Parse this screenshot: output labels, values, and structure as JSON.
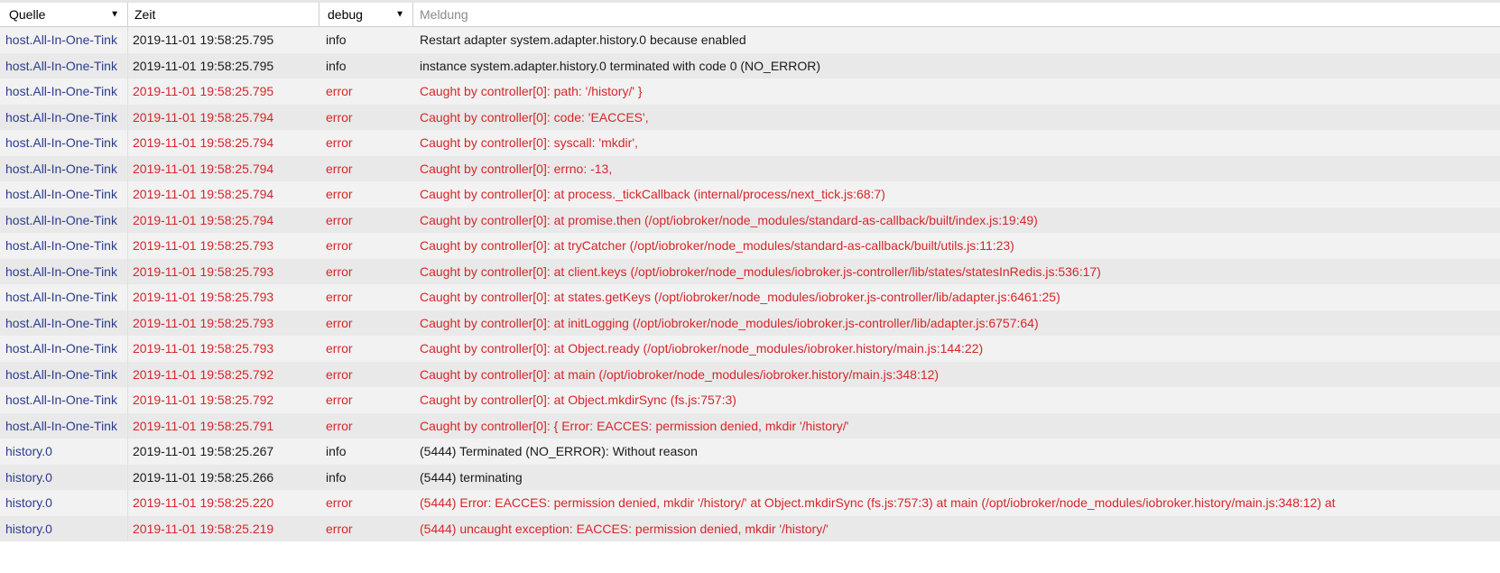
{
  "header": {
    "source_label": "Quelle",
    "time_label": "Zeit",
    "level_label": "debug",
    "message_placeholder": "Meldung"
  },
  "colors": {
    "source_text": "#2d3c8f",
    "error_text": "#d6262a",
    "info_text": "#1a1a1a",
    "row_odd": "#f2f2f2",
    "row_even": "#e9e9e9"
  },
  "rows": [
    {
      "source": "host.All-In-One-Tink",
      "time": "2019-11-01 19:58:25.795",
      "level": "info",
      "message": "Restart adapter system.adapter.history.0 because enabled"
    },
    {
      "source": "host.All-In-One-Tink",
      "time": "2019-11-01 19:58:25.795",
      "level": "info",
      "message": "instance system.adapter.history.0 terminated with code 0 (NO_ERROR)"
    },
    {
      "source": "host.All-In-One-Tink",
      "time": "2019-11-01 19:58:25.795",
      "level": "error",
      "message": "Caught by controller[0]: path: '/history/' }"
    },
    {
      "source": "host.All-In-One-Tink",
      "time": "2019-11-01 19:58:25.794",
      "level": "error",
      "message": "Caught by controller[0]: code: 'EACCES',"
    },
    {
      "source": "host.All-In-One-Tink",
      "time": "2019-11-01 19:58:25.794",
      "level": "error",
      "message": "Caught by controller[0]: syscall: 'mkdir',"
    },
    {
      "source": "host.All-In-One-Tink",
      "time": "2019-11-01 19:58:25.794",
      "level": "error",
      "message": "Caught by controller[0]: errno: -13,"
    },
    {
      "source": "host.All-In-One-Tink",
      "time": "2019-11-01 19:58:25.794",
      "level": "error",
      "message": "Caught by controller[0]: at process._tickCallback (internal/process/next_tick.js:68:7)"
    },
    {
      "source": "host.All-In-One-Tink",
      "time": "2019-11-01 19:58:25.794",
      "level": "error",
      "message": "Caught by controller[0]: at promise.then (/opt/iobroker/node_modules/standard-as-callback/built/index.js:19:49)"
    },
    {
      "source": "host.All-In-One-Tink",
      "time": "2019-11-01 19:58:25.793",
      "level": "error",
      "message": "Caught by controller[0]: at tryCatcher (/opt/iobroker/node_modules/standard-as-callback/built/utils.js:11:23)"
    },
    {
      "source": "host.All-In-One-Tink",
      "time": "2019-11-01 19:58:25.793",
      "level": "error",
      "message": "Caught by controller[0]: at client.keys (/opt/iobroker/node_modules/iobroker.js-controller/lib/states/statesInRedis.js:536:17)"
    },
    {
      "source": "host.All-In-One-Tink",
      "time": "2019-11-01 19:58:25.793",
      "level": "error",
      "message": "Caught by controller[0]: at states.getKeys (/opt/iobroker/node_modules/iobroker.js-controller/lib/adapter.js:6461:25)"
    },
    {
      "source": "host.All-In-One-Tink",
      "time": "2019-11-01 19:58:25.793",
      "level": "error",
      "message": "Caught by controller[0]: at initLogging (/opt/iobroker/node_modules/iobroker.js-controller/lib/adapter.js:6757:64)"
    },
    {
      "source": "host.All-In-One-Tink",
      "time": "2019-11-01 19:58:25.793",
      "level": "error",
      "message": "Caught by controller[0]: at Object.ready (/opt/iobroker/node_modules/iobroker.history/main.js:144:22)"
    },
    {
      "source": "host.All-In-One-Tink",
      "time": "2019-11-01 19:58:25.792",
      "level": "error",
      "message": "Caught by controller[0]: at main (/opt/iobroker/node_modules/iobroker.history/main.js:348:12)"
    },
    {
      "source": "host.All-In-One-Tink",
      "time": "2019-11-01 19:58:25.792",
      "level": "error",
      "message": "Caught by controller[0]: at Object.mkdirSync (fs.js:757:3)"
    },
    {
      "source": "host.All-In-One-Tink",
      "time": "2019-11-01 19:58:25.791",
      "level": "error",
      "message": "Caught by controller[0]: { Error: EACCES: permission denied, mkdir '/history/'"
    },
    {
      "source": "history.0",
      "time": "2019-11-01 19:58:25.267",
      "level": "info",
      "message": "(5444) Terminated (NO_ERROR): Without reason"
    },
    {
      "source": "history.0",
      "time": "2019-11-01 19:58:25.266",
      "level": "info",
      "message": "(5444) terminating"
    },
    {
      "source": "history.0",
      "time": "2019-11-01 19:58:25.220",
      "level": "error",
      "message": "(5444) Error: EACCES: permission denied, mkdir '/history/' at Object.mkdirSync (fs.js:757:3) at main (/opt/iobroker/node_modules/iobroker.history/main.js:348:12) at"
    },
    {
      "source": "history.0",
      "time": "2019-11-01 19:58:25.219",
      "level": "error",
      "message": "(5444) uncaught exception: EACCES: permission denied, mkdir '/history/'"
    }
  ]
}
